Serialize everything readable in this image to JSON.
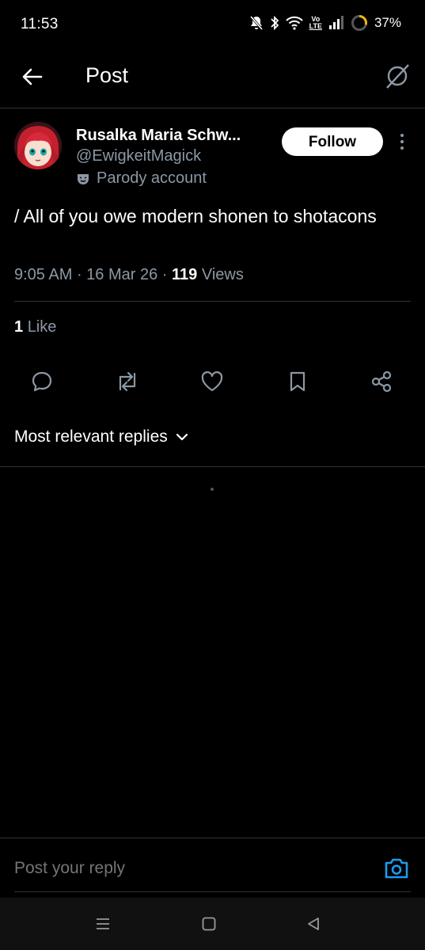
{
  "status_bar": {
    "time": "11:53",
    "battery": "37%",
    "icons": [
      "mute-icon",
      "bluetooth-icon",
      "wifi-icon",
      "volte-icon",
      "signal-icon",
      "battery-ring-icon"
    ],
    "volte_label_top": "Vo",
    "volte_label_bottom": "LTE"
  },
  "header": {
    "title": "Post",
    "back_icon": "arrow-left-icon",
    "grok_icon": "grok-icon"
  },
  "author": {
    "display_name": "Rusalka Maria Schw...",
    "handle": "@EwigkeitMagick",
    "badge": "Parody account",
    "follow_label": "Follow"
  },
  "post": {
    "text": "/ All of you owe modern shonen to shotacons",
    "time": "9:05 AM",
    "date": "16 Mar 26",
    "views_count": "119",
    "views_label": "Views",
    "likes_count": "1",
    "likes_label": "Like"
  },
  "actions": [
    "reply-icon",
    "repost-icon",
    "like-icon",
    "bookmark-icon",
    "share-icon"
  ],
  "replies": {
    "sort_label": "Most relevant replies"
  },
  "composer": {
    "placeholder": "Post your reply"
  },
  "colors": {
    "background": "#000000",
    "muted_text": "#8b98a5",
    "divider": "#2f3336",
    "accent": "#1d9bf0"
  }
}
